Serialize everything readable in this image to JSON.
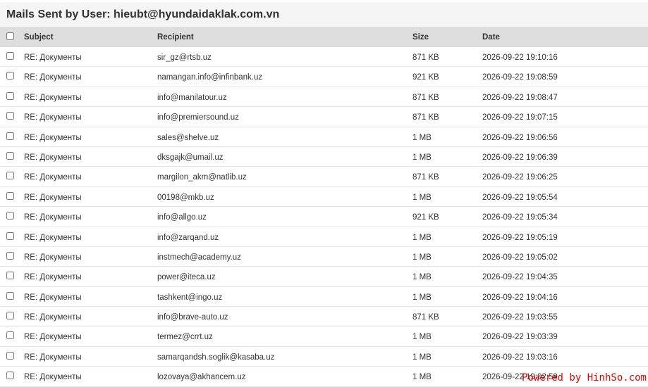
{
  "page_title": "Mails Sent by User: hieubt@hyundaidaklak.com.vn",
  "table": {
    "columns": {
      "subject": "Subject",
      "recipient": "Recipient",
      "size": "Size",
      "date": "Date"
    },
    "rows": [
      {
        "subject": "RE: Документы",
        "recipient": "sir_gz@rtsb.uz",
        "size": "871 KB",
        "date": "2026-09-22 19:10:16"
      },
      {
        "subject": "RE: Документы",
        "recipient": "namangan.info@infinbank.uz",
        "size": "921 KB",
        "date": "2026-09-22 19:08:59"
      },
      {
        "subject": "RE: Документы",
        "recipient": "info@manilatour.uz",
        "size": "871 KB",
        "date": "2026-09-22 19:08:47"
      },
      {
        "subject": "RE: Документы",
        "recipient": "info@premiersound.uz",
        "size": "871 KB",
        "date": "2026-09-22 19:07:15"
      },
      {
        "subject": "RE: Документы",
        "recipient": "sales@shelve.uz",
        "size": "1 MB",
        "date": "2026-09-22 19:06:56"
      },
      {
        "subject": "RE: Документы",
        "recipient": "dksgajk@umail.uz",
        "size": "1 MB",
        "date": "2026-09-22 19:06:39"
      },
      {
        "subject": "RE: Документы",
        "recipient": "margilon_akm@natlib.uz",
        "size": "871 KB",
        "date": "2026-09-22 19:06:25"
      },
      {
        "subject": "RE: Документы",
        "recipient": "00198@mkb.uz",
        "size": "1 MB",
        "date": "2026-09-22 19:05:54"
      },
      {
        "subject": "RE: Документы",
        "recipient": "info@allgo.uz",
        "size": "921 KB",
        "date": "2026-09-22 19:05:34"
      },
      {
        "subject": "RE: Документы",
        "recipient": "info@zarqand.uz",
        "size": "1 MB",
        "date": "2026-09-22 19:05:19"
      },
      {
        "subject": "RE: Документы",
        "recipient": "instmech@academy.uz",
        "size": "1 MB",
        "date": "2026-09-22 19:05:02"
      },
      {
        "subject": "RE: Документы",
        "recipient": "power@iteca.uz",
        "size": "1 MB",
        "date": "2026-09-22 19:04:35"
      },
      {
        "subject": "RE: Документы",
        "recipient": "tashkent@ingo.uz",
        "size": "1 MB",
        "date": "2026-09-22 19:04:16"
      },
      {
        "subject": "RE: Документы",
        "recipient": "info@brave-auto.uz",
        "size": "871 KB",
        "date": "2026-09-22 19:03:55"
      },
      {
        "subject": "RE: Документы",
        "recipient": "termez@crrt.uz",
        "size": "1 MB",
        "date": "2026-09-22 19:03:39"
      },
      {
        "subject": "RE: Документы",
        "recipient": "samarqandsh.soglik@kasaba.uz",
        "size": "1 MB",
        "date": "2026-09-22 19:03:16"
      },
      {
        "subject": "RE: Документы",
        "recipient": "lozovaya@akhancem.uz",
        "size": "1 MB",
        "date": "2026-09-22 19:02:59"
      }
    ]
  },
  "watermark": "Powered by HinhSo.com",
  "colors": {
    "header_bg": "#dedede",
    "title_bg": "#f5f5f5",
    "watermark": "#e00000"
  }
}
